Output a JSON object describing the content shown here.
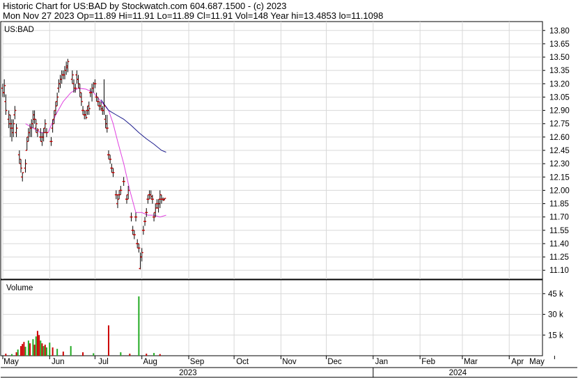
{
  "header": {
    "line1": "Historic Chart for US:BAD by Stockwatch.com 604.687.1500 - (c) 2023",
    "line2": "Mon Nov 27 2023   Op=11.89  Hi=11.91  Lo=11.89  Cl=11.91  Vol=148   Year hi=13.4853   lo=11.1098"
  },
  "colors": {
    "bar": "#cc0000",
    "bar_tick": "#000000",
    "ma_short": "#e040e0",
    "ma_long": "#1a1a8c",
    "vol_up": "#22aa22",
    "vol_down": "#cc0000",
    "grid": "#d8d8d8"
  },
  "chart_data": [
    {
      "type": "ohlc",
      "symbol_label": "US:BAD",
      "yticks": [
        "13.80",
        "13.65",
        "13.50",
        "13.35",
        "13.20",
        "13.05",
        "12.90",
        "12.75",
        "12.60",
        "12.45",
        "12.30",
        "12.15",
        "12.00",
        "11.85",
        "11.70",
        "11.55",
        "11.40",
        "11.25",
        "11.10"
      ],
      "ylim": [
        11.0,
        13.9
      ],
      "xlim": [
        0,
        357
      ],
      "month_labels": [
        "May",
        "Jun",
        "Jul",
        "Aug",
        "Sep",
        "Oct",
        "Nov",
        "Dec",
        "Jan",
        "Feb",
        "Mar",
        "Apr",
        "May"
      ],
      "month_days": [
        0,
        31,
        61,
        92,
        123,
        153,
        184,
        214,
        245,
        276,
        304,
        335,
        365
      ],
      "year_labels": [
        "2023",
        "2024"
      ],
      "bars": [
        [
          0,
          13.15,
          13.2,
          13.05,
          13.1
        ],
        [
          1,
          13.1,
          13.25,
          13.05,
          13.18
        ],
        [
          2,
          13.0,
          13.08,
          12.85,
          12.9
        ],
        [
          4,
          12.8,
          12.9,
          12.7,
          12.85
        ],
        [
          5,
          12.75,
          12.85,
          12.6,
          12.75
        ],
        [
          6,
          12.7,
          12.8,
          12.55,
          12.65
        ],
        [
          7,
          12.7,
          12.8,
          12.6,
          12.75
        ],
        [
          8,
          12.85,
          12.95,
          12.8,
          12.9
        ],
        [
          9,
          12.65,
          12.75,
          12.6,
          12.7
        ],
        [
          11,
          12.4,
          12.45,
          12.3,
          12.35
        ],
        [
          12,
          12.3,
          12.35,
          12.2,
          12.25
        ],
        [
          13,
          12.15,
          12.2,
          12.1,
          12.2
        ],
        [
          15,
          12.25,
          12.35,
          12.2,
          12.3
        ],
        [
          16,
          12.45,
          12.6,
          12.45,
          12.55
        ],
        [
          17,
          12.6,
          12.7,
          12.55,
          12.65
        ],
        [
          18,
          12.65,
          12.75,
          12.6,
          12.7
        ],
        [
          19,
          12.7,
          12.8,
          12.6,
          12.75
        ],
        [
          20,
          12.75,
          12.9,
          12.7,
          12.85
        ],
        [
          21,
          12.8,
          12.9,
          12.75,
          12.8
        ],
        [
          22,
          12.7,
          12.8,
          12.65,
          12.75
        ],
        [
          23,
          12.65,
          12.7,
          12.6,
          12.68
        ],
        [
          25,
          12.6,
          12.7,
          12.55,
          12.6
        ],
        [
          26,
          12.55,
          12.65,
          12.5,
          12.6
        ],
        [
          27,
          12.6,
          12.7,
          12.55,
          12.65
        ],
        [
          28,
          12.7,
          12.8,
          12.65,
          12.75
        ],
        [
          29,
          12.65,
          12.7,
          12.6,
          12.65
        ],
        [
          32,
          12.55,
          12.6,
          12.5,
          12.55
        ],
        [
          33,
          12.7,
          12.8,
          12.65,
          12.75
        ],
        [
          34,
          12.8,
          12.9,
          12.75,
          12.85
        ],
        [
          35,
          12.9,
          13.0,
          12.85,
          12.95
        ],
        [
          36,
          13.0,
          13.1,
          12.95,
          13.05
        ],
        [
          37,
          13.15,
          13.25,
          13.1,
          13.2
        ],
        [
          38,
          13.2,
          13.3,
          13.15,
          13.25
        ],
        [
          39,
          13.25,
          13.35,
          13.2,
          13.3
        ],
        [
          40,
          13.3,
          13.35,
          13.25,
          13.3
        ],
        [
          41,
          13.3,
          13.4,
          13.25,
          13.35
        ],
        [
          42,
          13.35,
          13.45,
          13.3,
          13.4
        ],
        [
          43,
          13.38,
          13.48,
          13.33,
          13.45
        ],
        [
          46,
          13.25,
          13.35,
          13.2,
          13.3
        ],
        [
          47,
          13.2,
          13.25,
          13.1,
          13.15
        ],
        [
          48,
          13.15,
          13.2,
          13.1,
          13.15
        ],
        [
          49,
          13.3,
          13.35,
          13.2,
          13.25
        ],
        [
          50,
          13.25,
          13.3,
          13.15,
          13.2
        ],
        [
          51,
          13.15,
          13.2,
          13.05,
          13.1
        ],
        [
          52,
          13.05,
          13.1,
          12.95,
          13.0
        ],
        [
          53,
          12.9,
          12.95,
          12.85,
          12.9
        ],
        [
          54,
          12.85,
          12.9,
          12.8,
          12.85
        ],
        [
          55,
          12.85,
          12.9,
          12.8,
          12.82
        ],
        [
          56,
          12.9,
          12.95,
          12.85,
          12.9
        ],
        [
          57,
          12.95,
          13.0,
          12.85,
          12.92
        ],
        [
          58,
          13.1,
          13.15,
          13.05,
          13.1
        ],
        [
          59,
          13.1,
          13.2,
          13.0,
          13.15
        ],
        [
          60,
          13.15,
          13.22,
          13.1,
          13.2
        ],
        [
          61,
          13.2,
          13.25,
          13.15,
          13.2
        ],
        [
          62,
          13.05,
          13.1,
          13.0,
          13.05
        ],
        [
          63,
          13.0,
          13.05,
          12.95,
          13.0
        ],
        [
          64,
          12.95,
          13.0,
          12.9,
          12.95
        ],
        [
          65,
          12.95,
          13.0,
          12.9,
          12.92
        ],
        [
          66,
          12.9,
          12.95,
          12.85,
          12.9
        ],
        [
          67,
          12.9,
          13.25,
          12.85,
          12.95
        ],
        [
          68,
          12.8,
          12.85,
          12.7,
          12.75
        ],
        [
          69,
          12.7,
          12.85,
          12.65,
          12.7
        ],
        [
          70,
          12.4,
          12.45,
          12.35,
          12.4
        ],
        [
          71,
          12.35,
          12.4,
          12.3,
          12.35
        ],
        [
          72,
          12.25,
          12.3,
          12.2,
          12.25
        ],
        [
          73,
          12.2,
          12.25,
          12.15,
          12.2
        ],
        [
          75,
          11.95,
          12.0,
          11.9,
          11.95
        ],
        [
          76,
          11.85,
          11.95,
          11.8,
          11.9
        ],
        [
          77,
          11.95,
          12.0,
          11.9,
          11.95
        ],
        [
          78,
          12.0,
          12.05,
          11.95,
          12.0
        ],
        [
          80,
          12.1,
          12.15,
          12.05,
          12.1
        ],
        [
          82,
          11.9,
          11.95,
          11.85,
          11.9
        ],
        [
          83,
          11.95,
          12.05,
          11.9,
          12.0
        ],
        [
          85,
          11.7,
          11.75,
          11.65,
          11.7
        ],
        [
          86,
          11.55,
          11.6,
          11.5,
          11.55
        ],
        [
          87,
          11.5,
          11.55,
          11.45,
          11.5
        ],
        [
          88,
          11.7,
          11.75,
          11.65,
          11.7
        ],
        [
          89,
          11.4,
          11.45,
          11.35,
          11.4
        ],
        [
          90,
          11.35,
          11.4,
          11.3,
          11.35
        ],
        [
          91,
          11.12,
          11.3,
          11.11,
          11.25
        ],
        [
          92,
          11.25,
          11.35,
          11.2,
          11.3
        ],
        [
          93,
          11.55,
          11.6,
          11.5,
          11.55
        ],
        [
          94,
          11.65,
          11.7,
          11.6,
          11.65
        ],
        [
          95,
          11.75,
          11.8,
          11.7,
          11.75
        ],
        [
          96,
          11.9,
          11.95,
          11.85,
          11.9
        ],
        [
          97,
          11.95,
          12.0,
          11.9,
          11.95
        ],
        [
          98,
          11.95,
          12.0,
          11.9,
          11.93
        ],
        [
          99,
          11.9,
          11.95,
          11.85,
          11.9
        ],
        [
          100,
          11.7,
          11.75,
          11.65,
          11.7
        ],
        [
          101,
          11.75,
          11.85,
          11.7,
          11.8
        ],
        [
          102,
          11.85,
          11.9,
          11.8,
          11.85
        ],
        [
          103,
          11.8,
          11.9,
          11.75,
          11.85
        ],
        [
          104,
          11.9,
          12.0,
          11.8,
          11.95
        ],
        [
          105,
          11.9,
          11.95,
          11.85,
          11.9
        ],
        [
          106,
          11.9,
          11.92,
          11.88,
          11.9
        ],
        [
          107,
          11.89,
          11.91,
          11.89,
          11.91
        ]
      ],
      "ma_short": [
        [
          15,
          12.75
        ],
        [
          20,
          12.7
        ],
        [
          25,
          12.65
        ],
        [
          30,
          12.65
        ],
        [
          35,
          12.85
        ],
        [
          40,
          13.0
        ],
        [
          45,
          13.1
        ],
        [
          50,
          13.15
        ],
        [
          55,
          13.14
        ],
        [
          60,
          13.1
        ],
        [
          65,
          13.0
        ],
        [
          70,
          12.9
        ],
        [
          73,
          12.75
        ],
        [
          76,
          12.55
        ],
        [
          80,
          12.3
        ],
        [
          84,
          12.0
        ],
        [
          88,
          11.75
        ],
        [
          92,
          11.75
        ],
        [
          96,
          11.72
        ],
        [
          100,
          11.72
        ],
        [
          104,
          11.7
        ],
        [
          108,
          11.72
        ]
      ],
      "ma_long": [
        [
          65,
          13.02
        ],
        [
          70,
          12.9
        ],
        [
          75,
          12.85
        ],
        [
          80,
          12.8
        ],
        [
          85,
          12.73
        ],
        [
          90,
          12.65
        ],
        [
          95,
          12.58
        ],
        [
          100,
          12.52
        ],
        [
          105,
          12.45
        ],
        [
          108,
          12.43
        ]
      ]
    },
    {
      "type": "bar",
      "title": "Volume",
      "yticks": [
        "45 k",
        "30 k",
        "15 k"
      ],
      "yticks_values": [
        45000,
        30000,
        15000
      ],
      "ylim": [
        0,
        55000
      ],
      "bars": [
        [
          2,
          1500,
          "down"
        ],
        [
          6,
          1200,
          "up"
        ],
        [
          9,
          2500,
          "down"
        ],
        [
          10,
          4500,
          "up"
        ],
        [
          12,
          7000,
          "down"
        ],
        [
          13,
          8500,
          "down"
        ],
        [
          14,
          10000,
          "down"
        ],
        [
          15,
          6500,
          "up"
        ],
        [
          17,
          11000,
          "up"
        ],
        [
          18,
          9000,
          "down"
        ],
        [
          20,
          12000,
          "up"
        ],
        [
          21,
          8000,
          "down"
        ],
        [
          22,
          14000,
          "up"
        ],
        [
          23,
          18000,
          "down"
        ],
        [
          24,
          15000,
          "down"
        ],
        [
          25,
          11000,
          "up"
        ],
        [
          26,
          9000,
          "down"
        ],
        [
          27,
          7000,
          "up"
        ],
        [
          28,
          8000,
          "down"
        ],
        [
          29,
          6000,
          "up"
        ],
        [
          31,
          9500,
          "up"
        ],
        [
          33,
          6000,
          "down"
        ],
        [
          36,
          5000,
          "up"
        ],
        [
          40,
          3000,
          "down"
        ],
        [
          45,
          7000,
          "up"
        ],
        [
          53,
          2500,
          "down"
        ],
        [
          60,
          1800,
          "up"
        ],
        [
          70,
          22000,
          "down"
        ],
        [
          78,
          2500,
          "up"
        ],
        [
          84,
          1500,
          "down"
        ],
        [
          90,
          43000,
          "up"
        ],
        [
          95,
          1500,
          "down"
        ],
        [
          100,
          2000,
          "up"
        ],
        [
          104,
          1200,
          "down"
        ]
      ]
    }
  ]
}
